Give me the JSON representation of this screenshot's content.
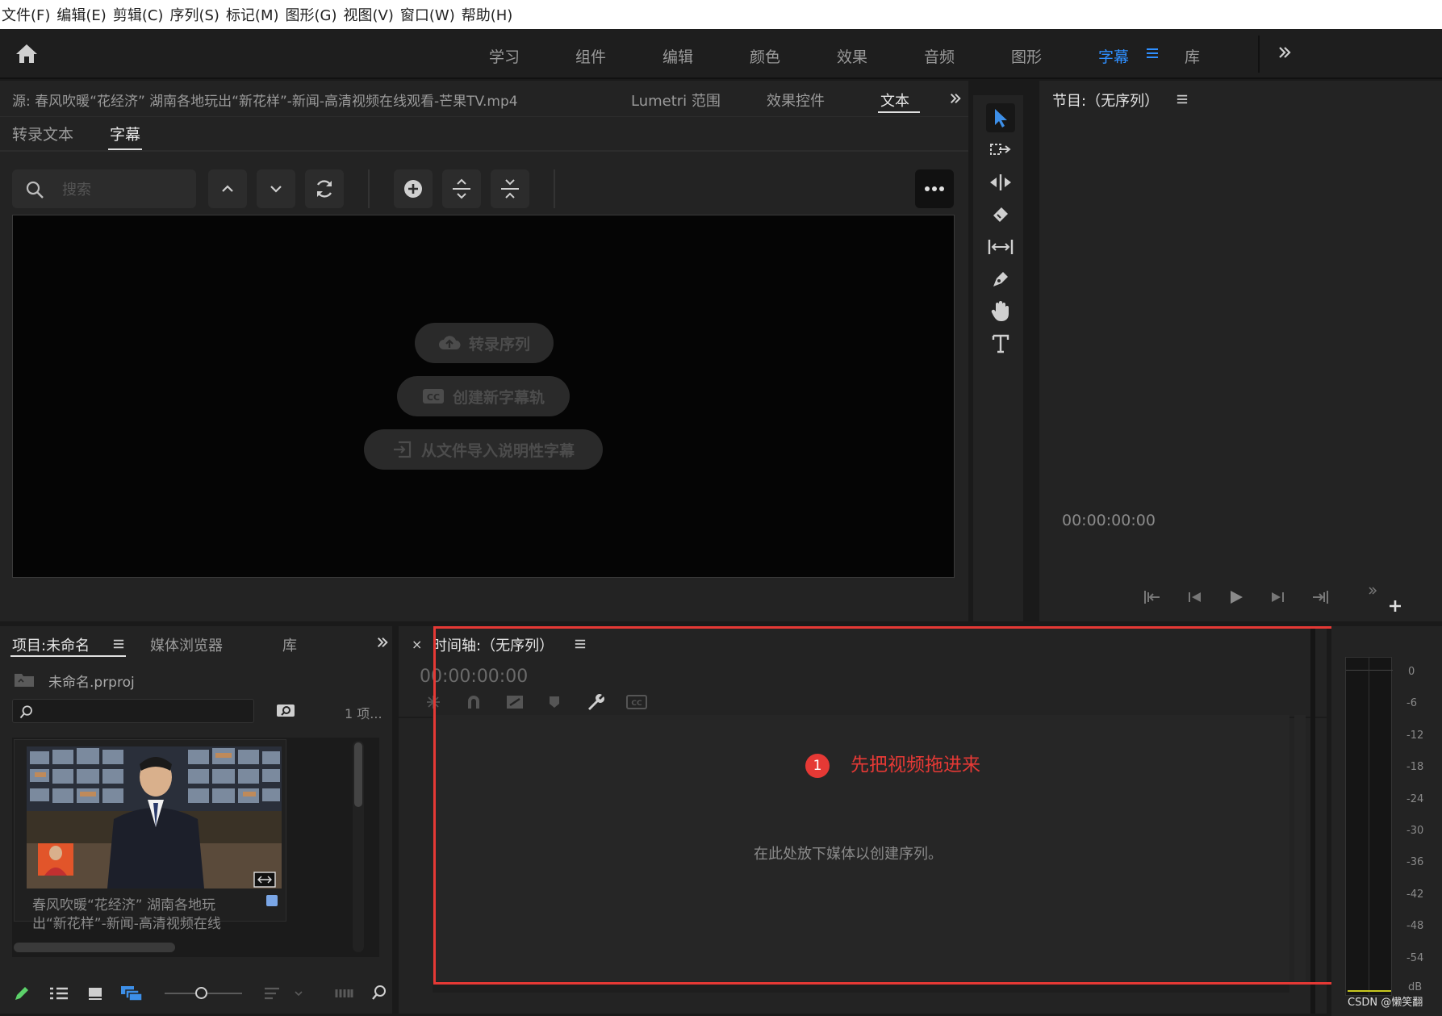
{
  "menu": [
    "文件(F)",
    "编辑(E)",
    "剪辑(C)",
    "序列(S)",
    "标记(M)",
    "图形(G)",
    "视图(V)",
    "窗口(W)",
    "帮助(H)"
  ],
  "workspaces": [
    "学习",
    "组件",
    "编辑",
    "颜色",
    "效果",
    "音频",
    "图形",
    "字幕",
    "库"
  ],
  "workspace_active": "字幕",
  "source_panel": {
    "tabs": [
      "源: 春风吹暖“花经济” 湖南各地玩出“新花样”-新闻-高清视频在线观看-芒果TV.mp4",
      "Lumetri 范围",
      "效果控件",
      "文本"
    ],
    "subtabs": [
      "转录文本",
      "字幕"
    ],
    "search_placeholder": "搜索",
    "buttons": [
      "转录序列",
      "创建新字幕轨",
      "从文件导入说明性字幕"
    ]
  },
  "program_panel": {
    "title": "节目:（无序列）",
    "timecode": "00:00:00:00"
  },
  "project_panel": {
    "tabs": [
      "项目:未命名",
      "媒体浏览器",
      "库"
    ],
    "file_name": "未命名.prproj",
    "item_count": "1 项...",
    "clip_name_line1": "春风吹暖“花经济” 湖南各地玩",
    "clip_name_line2": "出“新花样”-新闻-高清视频在线"
  },
  "timeline_panel": {
    "close": "×",
    "title": "时间轴:（无序列）",
    "timecode": "00:00:00:00",
    "drop_hint": "在此处放下媒体以创建序列。",
    "annotation_number": "1",
    "annotation_text": "先把视频拖进来"
  },
  "audio_meter": {
    "labels": [
      "0",
      "-6",
      "-12",
      "-18",
      "-24",
      "-30",
      "-36",
      "-42",
      "-48",
      "-54",
      "dB"
    ]
  },
  "watermark": "CSDN @懒笑翻",
  "colors": {
    "accent": "#2f8fff",
    "annotation": "#e53935",
    "tool_active": "#3d8fe8"
  }
}
